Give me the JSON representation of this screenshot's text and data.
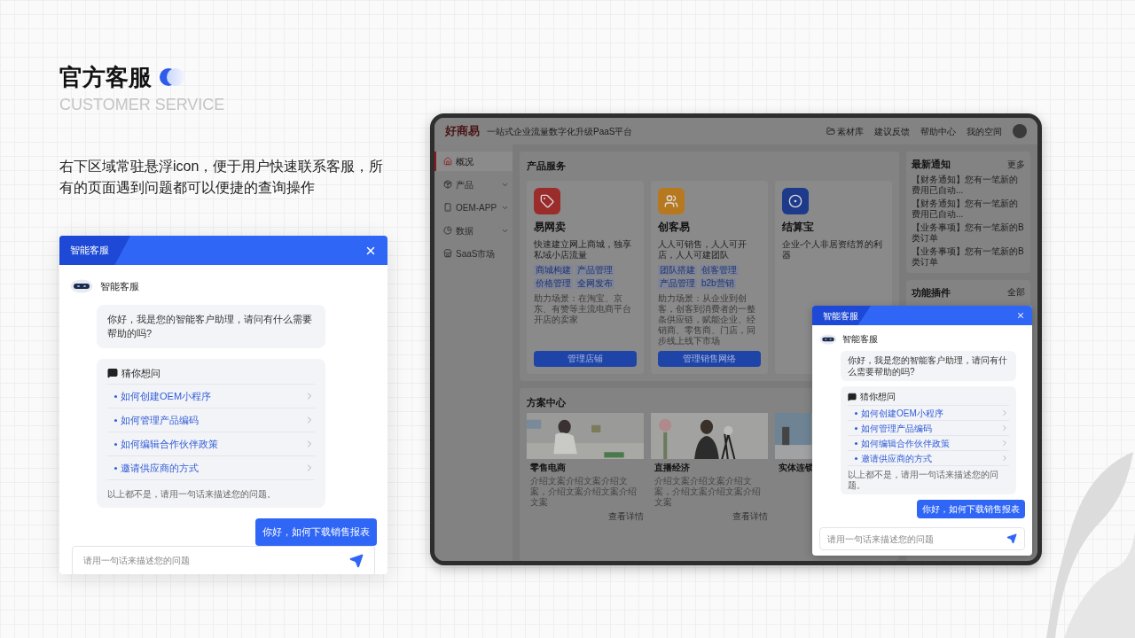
{
  "heading": {
    "title": "官方客服",
    "subtitle": "CUSTOMER SERVICE"
  },
  "description": "右下区域常驻悬浮icon，便于用户快速联系客服，所有的页面遇到问题都可以便捷的查询操作",
  "chat": {
    "title": "智能客服",
    "bot_name": "智能客服",
    "greeting": "你好，我是您的智能客户助理，请问有什么需要帮助的吗?",
    "suggest_title": "猜你想问",
    "suggestions": [
      "如何创建OEM小程序",
      "如何管理产品编码",
      "如何编辑合作伙伴政策",
      "邀请供应商的方式"
    ],
    "note": "以上都不是，请用一句话来描述您的问题。",
    "user_message": "你好，如何下载销售报表",
    "placeholder": "请用一句话来描述您的问题"
  },
  "tablet": {
    "logo": "好商易",
    "slogan": "一站式企业流量数字化升级PaaS平台",
    "top_links": [
      {
        "label": "素材库",
        "kind": "folder"
      },
      {
        "label": "建议反馈",
        "kind": "plain"
      },
      {
        "label": "帮助中心",
        "kind": "plain"
      },
      {
        "label": "我的空间",
        "kind": "plain"
      }
    ],
    "sidebar": [
      {
        "label": "概况",
        "kind": "home",
        "selected": true,
        "expandable": false
      },
      {
        "label": "产品",
        "kind": "box",
        "selected": false,
        "expandable": true
      },
      {
        "label": "OEM-APP",
        "kind": "phone",
        "selected": false,
        "expandable": true
      },
      {
        "label": "数据",
        "kind": "chart",
        "selected": false,
        "expandable": true
      },
      {
        "label": "SaaS市场",
        "kind": "store",
        "selected": false,
        "expandable": false
      }
    ],
    "products": {
      "title": "产品服务",
      "items": [
        {
          "name": "易网卖",
          "kind": "tag",
          "color": "#9b2c2c",
          "tagline": "快速建立网上商城，独享私域小店流量",
          "tags": [
            "商城构建",
            "产品管理",
            "价格管理",
            "全网发布"
          ],
          "desc": "助力场景：在淘宝、京东、有赞等主流电商平台开店的卖家",
          "button": "管理店铺"
        },
        {
          "name": "创客易",
          "kind": "people",
          "color": "#b7791f",
          "tagline": "人人可销售，人人可开店，人人可建团队",
          "tags": [
            "团队搭建",
            "创客管理",
            "产品管理",
            "b2b营销"
          ],
          "desc": "助力场景：从企业到创客，创客到消费者的一整条供应链，赋能企业、经销商、零售商、门店，同步线上线下市场",
          "button": "管理销售网络"
        },
        {
          "name": "结算宝",
          "kind": "coin",
          "color": "#1e3a8a",
          "tagline": "企业-个人非居资结算的利器"
        }
      ]
    },
    "notices": {
      "title": "最新通知",
      "more": "更多",
      "items": [
        "【财务通知】您有一笔新的费用已自动...",
        "【财务通知】您有一笔新的费用已自动...",
        "【业务事项】您有一笔新的B类订单",
        "【业务事项】您有一笔新的B类订单"
      ]
    },
    "plugins": {
      "title": "功能插件",
      "more": "全部"
    },
    "solutions": {
      "title": "方案中心",
      "items": [
        {
          "name": "零售电商",
          "kind": "room",
          "desc": "介绍文案介绍文案介绍文案，介绍文案介绍文案介绍文案",
          "link": "查看详情"
        },
        {
          "name": "直播经济",
          "kind": "studio",
          "desc": "介绍文案介绍文案介绍文案，介绍文案介绍文案介绍文案",
          "link": "查看详情"
        },
        {
          "name": "实体连锁",
          "kind": "building"
        }
      ]
    },
    "chat": {
      "title": "智能客服",
      "bot_name": "智能客服",
      "greeting": "你好，我是您的智能客户助理，请问有什么需要帮助的吗?",
      "suggest_title": "猜你想问",
      "suggestions": [
        "如何创建OEM小程序",
        "如何管理产品编码",
        "如何编辑合作伙伴政策",
        "邀请供应商的方式"
      ],
      "note": "以上都不是，请用一句话来描述您的问题。",
      "user_message": "你好，如何下载销售报表",
      "placeholder": "请用一句话来描述您的问题"
    }
  }
}
